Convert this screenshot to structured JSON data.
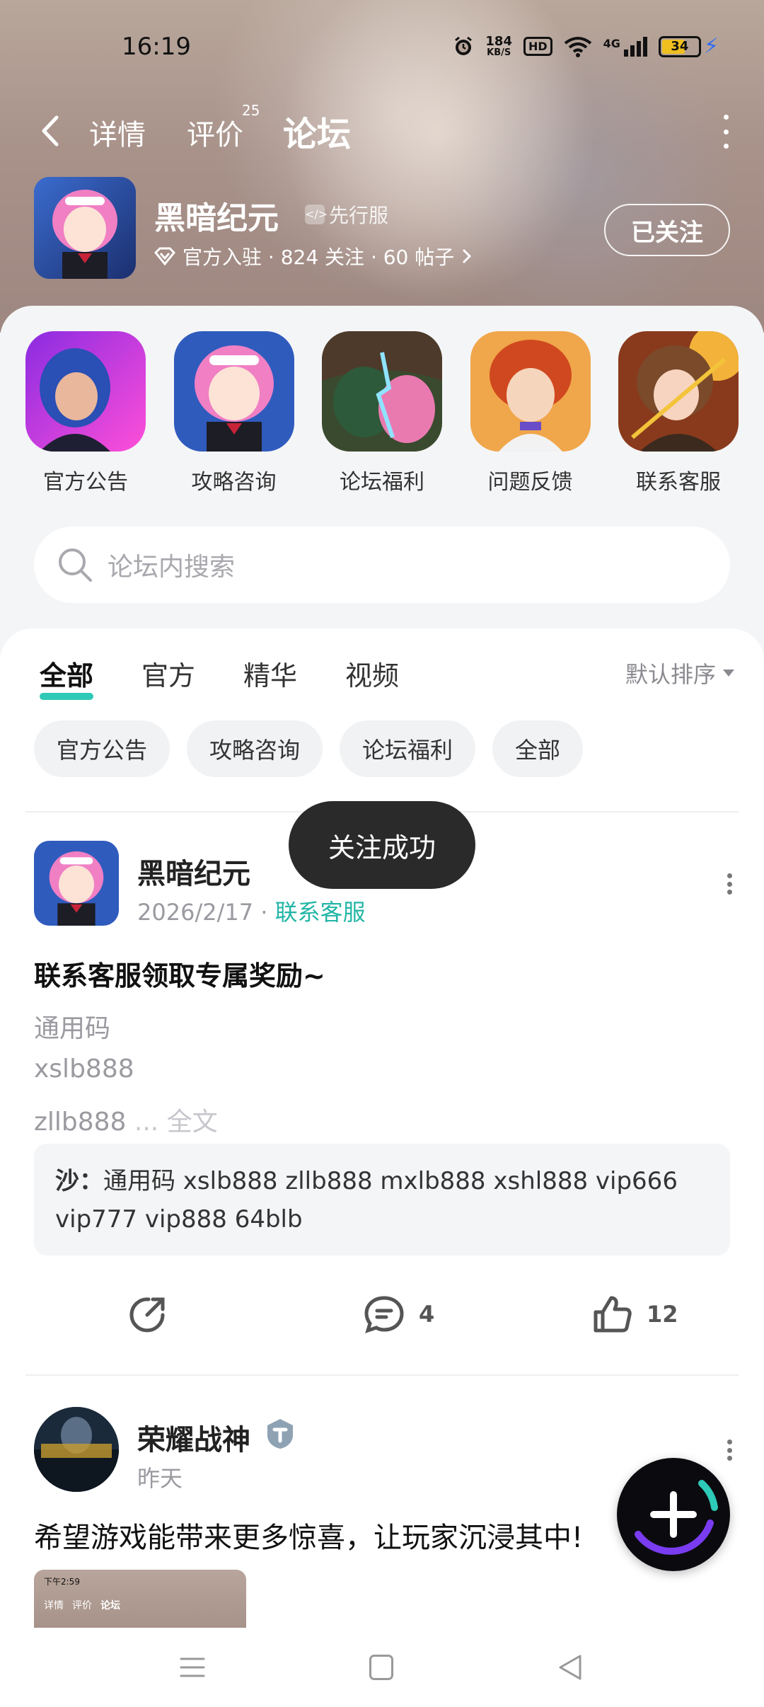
{
  "status_bar": {
    "time": "16:19",
    "net_speed_value": "184",
    "net_speed_unit": "KB/S",
    "hd_label": "HD",
    "network_label": "4G",
    "battery_level": "34"
  },
  "top_nav": {
    "tabs": [
      {
        "label": "详情"
      },
      {
        "label": "评价",
        "badge": "25"
      },
      {
        "label": "论坛"
      }
    ],
    "active_tab": "论坛"
  },
  "game": {
    "name": "黑暗纪元",
    "tag": "先行服",
    "meta": "官方入驻 · 824 关注 · 60 帖子",
    "follow_button": "已关注"
  },
  "quick_access": [
    {
      "label": "官方公告"
    },
    {
      "label": "攻略咨询"
    },
    {
      "label": "论坛福利"
    },
    {
      "label": "问题反馈"
    },
    {
      "label": "联系客服"
    }
  ],
  "search": {
    "placeholder": "论坛内搜索"
  },
  "filter_tabs": [
    "全部",
    "官方",
    "精华",
    "视频"
  ],
  "sort_label": "默认排序",
  "chips": [
    "官方公告",
    "攻略咨询",
    "论坛福利",
    "全部"
  ],
  "toast": "关注成功",
  "post1": {
    "author": "黑暗纪元",
    "date": "2026/2/17",
    "category": "联系客服",
    "title": "联系客服领取专属奖励~",
    "lines": [
      "通用码",
      "xslb888",
      "zllb888"
    ],
    "read_more": "... 全文",
    "quote_author": "沙：",
    "quote_text": "通用码  xslb888  zllb888  mxlb888   xshl888  vip666  vip777  vip888  64blb",
    "comments": "4",
    "likes": "12"
  },
  "post2": {
    "author": "荣耀战神",
    "date": "昨天",
    "text": "希望游戏能带来更多惊喜，让玩家沉浸其中!",
    "thumb_time": "下午2:59",
    "thumb_tabs": [
      "详情",
      "评价",
      "论坛"
    ]
  },
  "colors": {
    "accent": "#2ec9b7",
    "category_text": "#22b6a6",
    "toast_bg": "#2a2a2a"
  }
}
